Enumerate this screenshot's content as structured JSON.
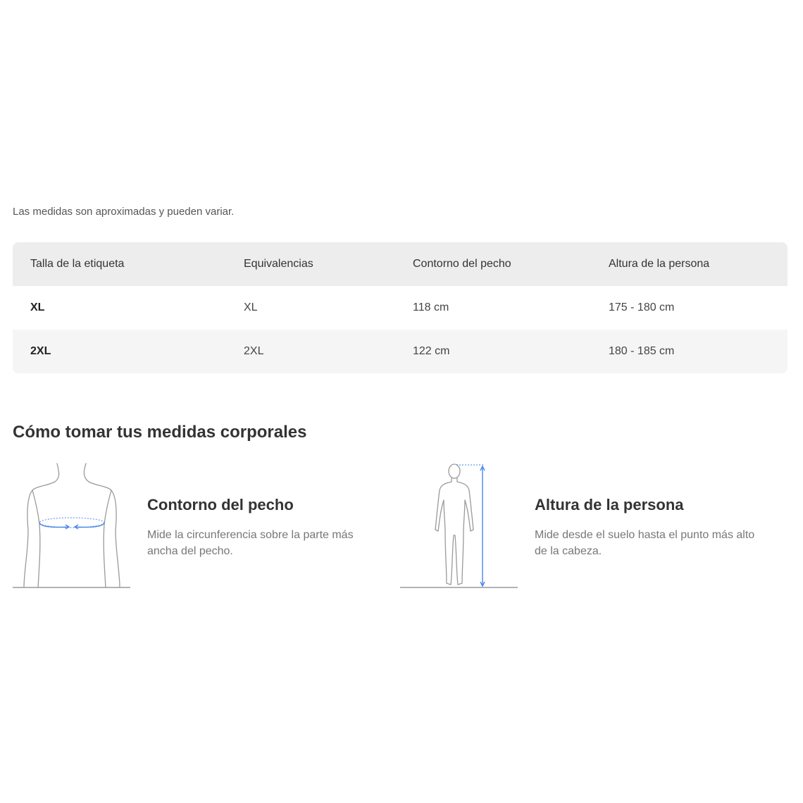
{
  "disclaimer": "Las medidas son aproximadas y pueden variar.",
  "table": {
    "headers": [
      "Talla de la etiqueta",
      "Equivalencias",
      "Contorno del pecho",
      "Altura de la persona"
    ],
    "rows": [
      {
        "size": "XL",
        "equivalence": "XL",
        "chest": "118 cm",
        "height": "175 - 180 cm"
      },
      {
        "size": "2XL",
        "equivalence": "2XL",
        "chest": "122 cm",
        "height": "180 - 185 cm"
      }
    ]
  },
  "guide": {
    "title": "Cómo tomar tus medidas corporales",
    "items": [
      {
        "icon": "torso-chest-measure-icon",
        "title": "Contorno del pecho",
        "description": "Mide la circunferencia sobre la parte más ancha del pecho."
      },
      {
        "icon": "body-height-measure-icon",
        "title": "Altura de la persona",
        "description": "Mide desde el suelo hasta el punto más alto de la cabeza."
      }
    ]
  },
  "colors": {
    "measure_accent": "#4a86e8",
    "outline": "#9a9a9a",
    "header_bg": "#ededed",
    "alt_row_bg": "#f5f5f5"
  }
}
